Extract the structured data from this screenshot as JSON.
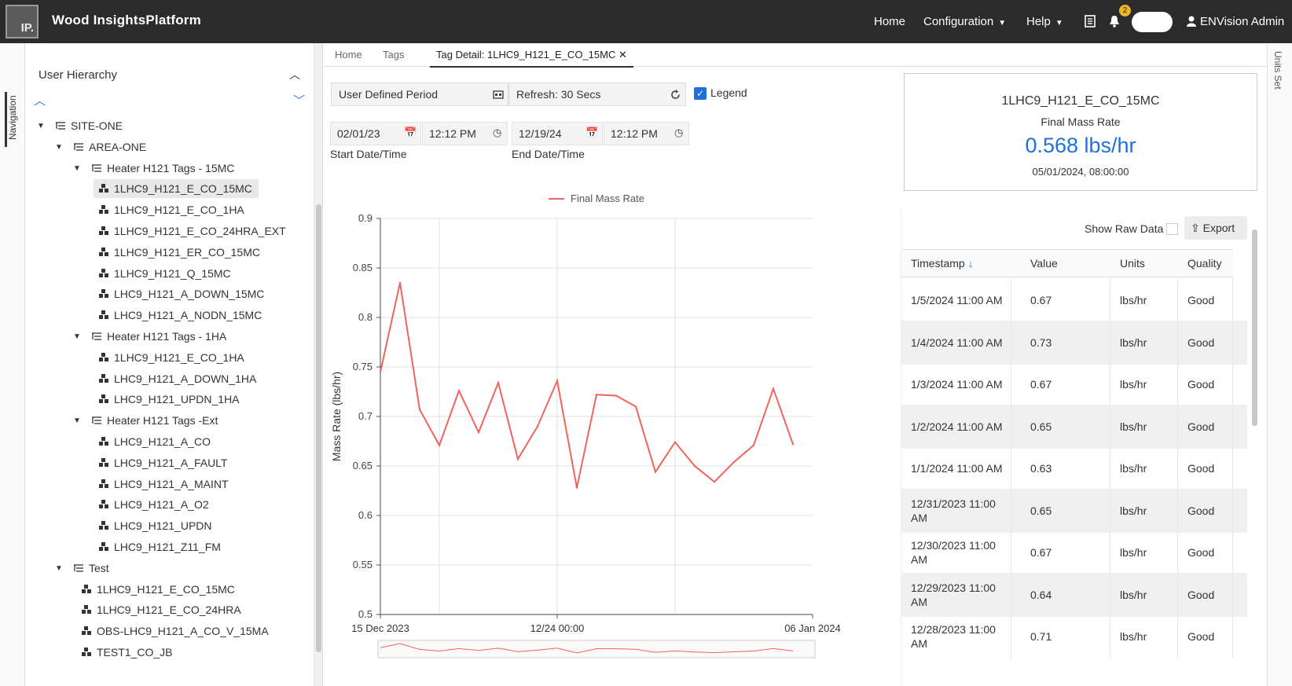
{
  "header": {
    "logo_text": "IP.",
    "app_title": "Wood InsightsPlatform",
    "nav": {
      "home": "Home",
      "configuration": "Configuration",
      "help": "Help"
    },
    "notification_count": "2",
    "user": "ENVision Admin"
  },
  "left_rail": {
    "navigation_label": "Navigation"
  },
  "right_rail": {
    "units_label": "Units Set"
  },
  "tree": {
    "title": "User Hierarchy",
    "nodes": [
      {
        "label": "SITE-ONE",
        "level": 0,
        "kind": "group",
        "expanded": true
      },
      {
        "label": "AREA-ONE",
        "level": 1,
        "kind": "group",
        "expanded": true
      },
      {
        "label": "Heater H121 Tags - 15MC",
        "level": 2,
        "kind": "group",
        "expanded": true
      },
      {
        "label": "1LHC9_H121_E_CO_15MC",
        "level": 3,
        "kind": "tag",
        "selected": true
      },
      {
        "label": "1LHC9_H121_E_CO_1HA",
        "level": 3,
        "kind": "tag"
      },
      {
        "label": "1LHC9_H121_E_CO_24HRA_EXT",
        "level": 3,
        "kind": "tag"
      },
      {
        "label": "1LHC9_H121_ER_CO_15MC",
        "level": 3,
        "kind": "tag"
      },
      {
        "label": "1LHC9_H121_Q_15MC",
        "level": 3,
        "kind": "tag"
      },
      {
        "label": "LHC9_H121_A_DOWN_15MC",
        "level": 3,
        "kind": "tag"
      },
      {
        "label": "LHC9_H121_A_NODN_15MC",
        "level": 3,
        "kind": "tag"
      },
      {
        "label": "Heater H121 Tags - 1HA",
        "level": 2,
        "kind": "group",
        "expanded": true
      },
      {
        "label": "1LHC9_H121_E_CO_1HA",
        "level": 3,
        "kind": "tag"
      },
      {
        "label": "LHC9_H121_A_DOWN_1HA",
        "level": 3,
        "kind": "tag"
      },
      {
        "label": "LHC9_H121_UPDN_1HA",
        "level": 3,
        "kind": "tag"
      },
      {
        "label": "Heater H121 Tags -Ext",
        "level": 2,
        "kind": "group",
        "expanded": true
      },
      {
        "label": "LHC9_H121_A_CO",
        "level": 3,
        "kind": "tag"
      },
      {
        "label": "LHC9_H121_A_FAULT",
        "level": 3,
        "kind": "tag"
      },
      {
        "label": "LHC9_H121_A_MAINT",
        "level": 3,
        "kind": "tag"
      },
      {
        "label": "LHC9_H121_A_O2",
        "level": 3,
        "kind": "tag"
      },
      {
        "label": "LHC9_H121_UPDN",
        "level": 3,
        "kind": "tag"
      },
      {
        "label": "LHC9_H121_Z11_FM",
        "level": 3,
        "kind": "tag"
      },
      {
        "label": "Test",
        "level": 1,
        "kind": "group",
        "expanded": true
      },
      {
        "label": "1LHC9_H121_E_CO_15MC",
        "level": 2,
        "kind": "tag"
      },
      {
        "label": "1LHC9_H121_E_CO_24HRA",
        "level": 2,
        "kind": "tag"
      },
      {
        "label": "OBS-LHC9_H121_A_CO_V_15MA",
        "level": 2,
        "kind": "tag"
      },
      {
        "label": "TEST1_CO_JB",
        "level": 2,
        "kind": "tag"
      }
    ]
  },
  "tabs": {
    "home": "Home",
    "tags": "Tags",
    "detail": "Tag Detail: 1LHC9_H121_E_CO_15MC"
  },
  "controls": {
    "period": "User Defined Period",
    "refresh": "Refresh: 30 Secs",
    "legend_label": "Legend",
    "legend_checked": true,
    "start_date": "02/01/23",
    "start_time": "12:12 PM",
    "start_label": "Start Date/Time",
    "end_date": "12/19/24",
    "end_time": "12:12 PM",
    "end_label": "End Date/Time"
  },
  "chart_data": {
    "type": "line",
    "legend": "Final Mass Rate",
    "ylabel": "Mass Rate (lbs/hr)",
    "ylim": [
      0.5,
      0.9
    ],
    "yticks": [
      "0.5",
      "0.55",
      "0.6",
      "0.65",
      "0.7",
      "0.75",
      "0.8",
      "0.85",
      "0.9"
    ],
    "x_tick_labels": [
      "15 Dec 2023",
      "12/24 00:00",
      "06 Jan 2024"
    ],
    "series": [
      {
        "name": "Final Mass Rate",
        "color": "#f0645a",
        "x": [
          "2023-12-15",
          "2023-12-16",
          "2023-12-17",
          "2023-12-18",
          "2023-12-19",
          "2023-12-20",
          "2023-12-21",
          "2023-12-22",
          "2023-12-23",
          "2023-12-24",
          "2023-12-25",
          "2023-12-26",
          "2023-12-27",
          "2023-12-28",
          "2023-12-29",
          "2023-12-30",
          "2023-12-31",
          "2024-01-01",
          "2024-01-02",
          "2024-01-03",
          "2024-01-04",
          "2024-01-05"
        ],
        "values": [
          0.745,
          0.835,
          0.707,
          0.671,
          0.726,
          0.684,
          0.734,
          0.657,
          0.69,
          0.736,
          0.628,
          0.722,
          0.721,
          0.71,
          0.644,
          0.674,
          0.65,
          0.634,
          0.654,
          0.671,
          0.728,
          0.672
        ]
      }
    ],
    "grid": true,
    "legend_position": "top"
  },
  "summary": {
    "tag": "1LHC9_H121_E_CO_15MC",
    "name": "Final Mass Rate",
    "value": "0.568 lbs/hr",
    "timestamp": "05/01/2024, 08:00:00"
  },
  "grid": {
    "show_raw_label": "Show Raw Data",
    "export_label": "Export",
    "columns": [
      "Timestamp",
      "Value",
      "Units",
      "Quality"
    ],
    "rows": [
      [
        "1/5/2024 11:00 AM",
        "0.67",
        "lbs/hr",
        "Good"
      ],
      [
        "1/4/2024 11:00 AM",
        "0.73",
        "lbs/hr",
        "Good"
      ],
      [
        "1/3/2024 11:00 AM",
        "0.67",
        "lbs/hr",
        "Good"
      ],
      [
        "1/2/2024 11:00 AM",
        "0.65",
        "lbs/hr",
        "Good"
      ],
      [
        "1/1/2024 11:00 AM",
        "0.63",
        "lbs/hr",
        "Good"
      ],
      [
        "12/31/2023 11:00 AM",
        "0.65",
        "lbs/hr",
        "Good"
      ],
      [
        "12/30/2023 11:00 AM",
        "0.67",
        "lbs/hr",
        "Good"
      ],
      [
        "12/29/2023 11:00 AM",
        "0.64",
        "lbs/hr",
        "Good"
      ],
      [
        "12/28/2023 11:00 AM",
        "0.71",
        "lbs/hr",
        "Good"
      ]
    ]
  }
}
